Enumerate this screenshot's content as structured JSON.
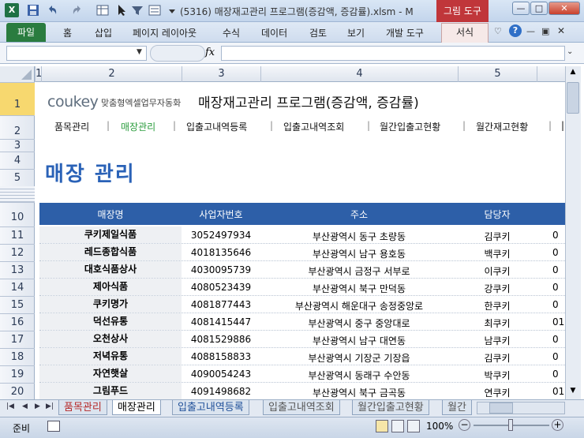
{
  "window": {
    "title": "(5316) 매장재고관리 프로그램(증감액, 증감률).xlsm - M",
    "context_tab": "그림 도구",
    "controls": [
      "—",
      "□",
      "✕"
    ]
  },
  "ribbon": {
    "file": "파일",
    "tabs": [
      "홈",
      "삽입",
      "페이지 레이아웃",
      "수식",
      "데이터",
      "검토",
      "보기",
      "개발 도구"
    ],
    "format_tab": "서식"
  },
  "formula_bar": {
    "name_box": "",
    "fx": "fx",
    "value": ""
  },
  "columns": [
    "1",
    "2",
    "3",
    "4",
    "5"
  ],
  "rows": [
    "1",
    "2",
    "3",
    "4",
    "5",
    "10",
    "11",
    "12",
    "13",
    "14",
    "15",
    "16",
    "17",
    "18",
    "19",
    "20"
  ],
  "sheet": {
    "logo_main": "coukey",
    "logo_sub": "맞춤형엑셀업무자동화",
    "app_title": "매장재고관리 프로그램(증감액, 증감률)",
    "nav": [
      "품목관리",
      "매장관리",
      "입출고내역등록",
      "입출고내역조회",
      "월간입출고현황",
      "월간재고현황",
      "|"
    ],
    "page_heading": "매장 관리",
    "table_headers": [
      "매장명",
      "사업자번호",
      "주소",
      "담당자"
    ],
    "table_rows": [
      {
        "name": "쿠키제일식품",
        "biz": "3052497934",
        "addr": "부산광역시 동구 초량동",
        "mgr": "김쿠키",
        "extra": "0"
      },
      {
        "name": "레드종합식품",
        "biz": "4018135646",
        "addr": "부산광역시 남구 용호동",
        "mgr": "백쿠키",
        "extra": "0"
      },
      {
        "name": "대호식품상사",
        "biz": "4030095739",
        "addr": "부산광역시 금정구 서부로",
        "mgr": "이쿠키",
        "extra": "0"
      },
      {
        "name": "제아식품",
        "biz": "4080523439",
        "addr": "부산광역시 북구 만덕동",
        "mgr": "강쿠키",
        "extra": "0"
      },
      {
        "name": "쿠키명가",
        "biz": "4081877443",
        "addr": "부산광역시 해운대구 송정중앙로",
        "mgr": "한쿠키",
        "extra": "0"
      },
      {
        "name": "덕선유통",
        "biz": "4081415447",
        "addr": "부산광역시 중구 중앙대로",
        "mgr": "최쿠키",
        "extra": "01"
      },
      {
        "name": "오천상사",
        "biz": "4081529886",
        "addr": "부산광역시 남구 대연동",
        "mgr": "남쿠키",
        "extra": "0"
      },
      {
        "name": "저녁유통",
        "biz": "4088158833",
        "addr": "부산광역시 기장군 기장읍",
        "mgr": "김쿠키",
        "extra": "0"
      },
      {
        "name": "자연햇살",
        "biz": "4090054243",
        "addr": "부산광역시 동래구 수안동",
        "mgr": "박쿠키",
        "extra": "0"
      },
      {
        "name": "그림푸드",
        "biz": "4091498682",
        "addr": "부산광역시 북구 금곡동",
        "mgr": "연쿠키",
        "extra": "01"
      }
    ]
  },
  "sheet_tabs": [
    "품목관리",
    "매장관리",
    "입출고내역등록",
    "입출고내역조회",
    "월간입출고현황",
    "월간"
  ],
  "status": {
    "ready": "준비",
    "zoom": "100%"
  }
}
